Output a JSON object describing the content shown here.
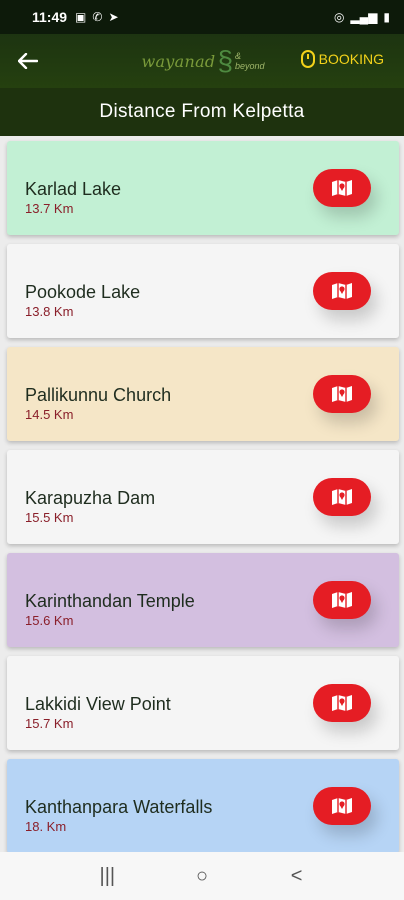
{
  "status_bar": {
    "time": "11:49",
    "left_icons": [
      "image-icon",
      "phone-icon",
      "telegram-icon"
    ],
    "right_icons": [
      "hotspot-icon",
      "signal-icon",
      "battery-icon"
    ]
  },
  "header": {
    "logo_text": "wayanad",
    "logo_sub": "& beyond",
    "booking_label": "BOOKING"
  },
  "title": "Distance From Kelpetta",
  "places": [
    {
      "name": "Karlad Lake",
      "distance": "13.7 Km",
      "bg": "#c2f0d4"
    },
    {
      "name": "Pookode Lake",
      "distance": "13.8 Km",
      "bg": "#f5f5f5"
    },
    {
      "name": "Pallikunnu Church",
      "distance": "14.5 Km",
      "bg": "#f5e6c7"
    },
    {
      "name": "Karapuzha Dam",
      "distance": "15.5 Km",
      "bg": "#f5f5f5"
    },
    {
      "name": "Karinthandan Temple",
      "distance": "15.6 Km",
      "bg": "#d3bfe0"
    },
    {
      "name": "Lakkidi View Point",
      "distance": "15.7 Km",
      "bg": "#f5f5f5"
    },
    {
      "name": "Kanthanpara Waterfalls",
      "distance": "18. Km",
      "bg": "#b6d4f5"
    }
  ],
  "colors": {
    "accent_red": "#e51d24",
    "header_green": "#1e320e",
    "booking_yellow": "#f3d21a"
  },
  "nav": {
    "recent_icon": "|||",
    "home_icon": "○",
    "back_icon": "<"
  }
}
